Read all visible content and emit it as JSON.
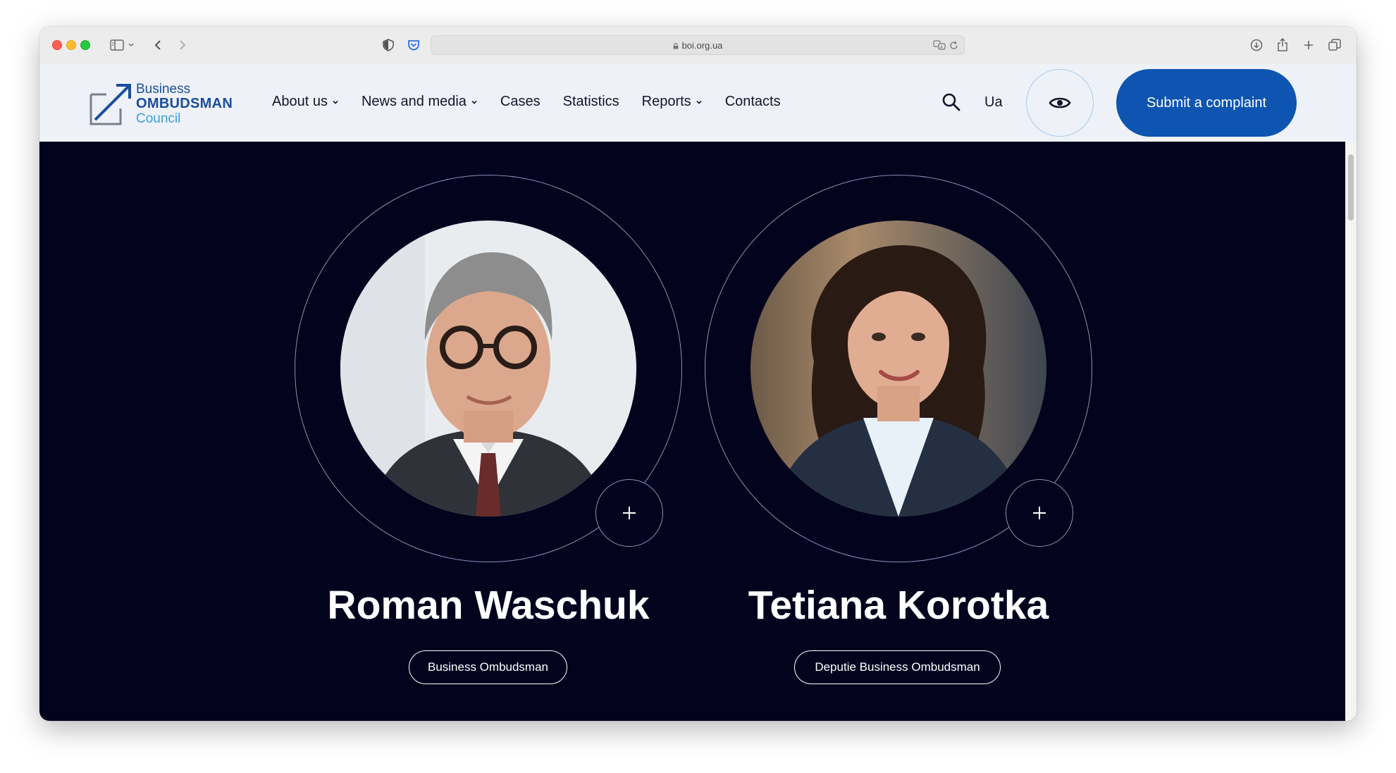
{
  "browser": {
    "url": "boi.org.ua"
  },
  "header": {
    "logo": {
      "line1": "Business",
      "line2": "OMBUDSMAN",
      "line3": "Council"
    },
    "nav": [
      {
        "label": "About us",
        "has_dropdown": true
      },
      {
        "label": "News and media",
        "has_dropdown": true
      },
      {
        "label": "Cases",
        "has_dropdown": false
      },
      {
        "label": "Statistics",
        "has_dropdown": false
      },
      {
        "label": "Reports",
        "has_dropdown": true
      },
      {
        "label": "Contacts",
        "has_dropdown": false
      }
    ],
    "language": "Ua",
    "cta_label": "Submit a complaint",
    "colors": {
      "cta": "#0d55b0",
      "header_bg": "#eef2f8"
    }
  },
  "team": {
    "background": "#03031e",
    "members": [
      {
        "name": "Roman Waschuk",
        "role": "Business Ombudsman"
      },
      {
        "name": "Tetiana Korotka",
        "role": "Deputie Business Ombudsman"
      }
    ]
  }
}
